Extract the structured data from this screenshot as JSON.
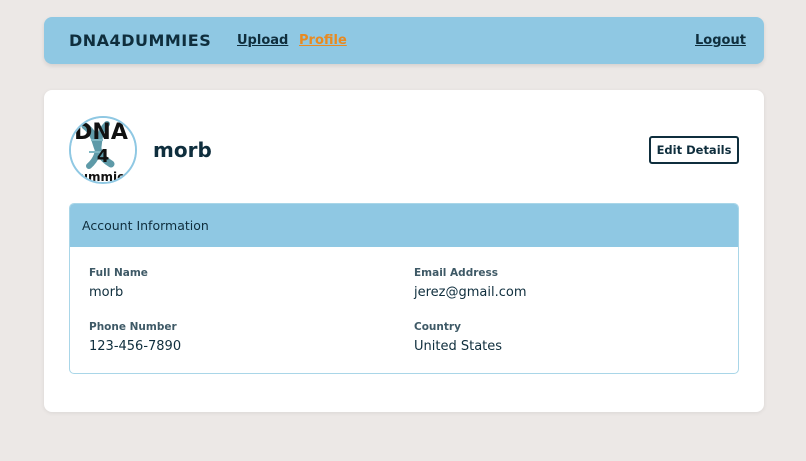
{
  "navbar": {
    "brand": "DNA4DUMMIES",
    "links": [
      {
        "label": "Upload",
        "active": false
      },
      {
        "label": "Profile",
        "active": true
      }
    ],
    "logout_label": "Logout",
    "background_color": "#8fc8e3",
    "active_color": "#e88a21"
  },
  "profile": {
    "username": "morb",
    "avatar_text": [
      "DNA",
      "4",
      "Dummies"
    ],
    "edit_button_label": "Edit Details"
  },
  "account_info": {
    "title": "Account Information",
    "fields": [
      {
        "label": "Full Name",
        "value": "morb"
      },
      {
        "label": "Email Address",
        "value": "jerez@gmail.com"
      },
      {
        "label": "Phone Number",
        "value": "123-456-7890"
      },
      {
        "label": "Country",
        "value": "United States"
      }
    ]
  }
}
